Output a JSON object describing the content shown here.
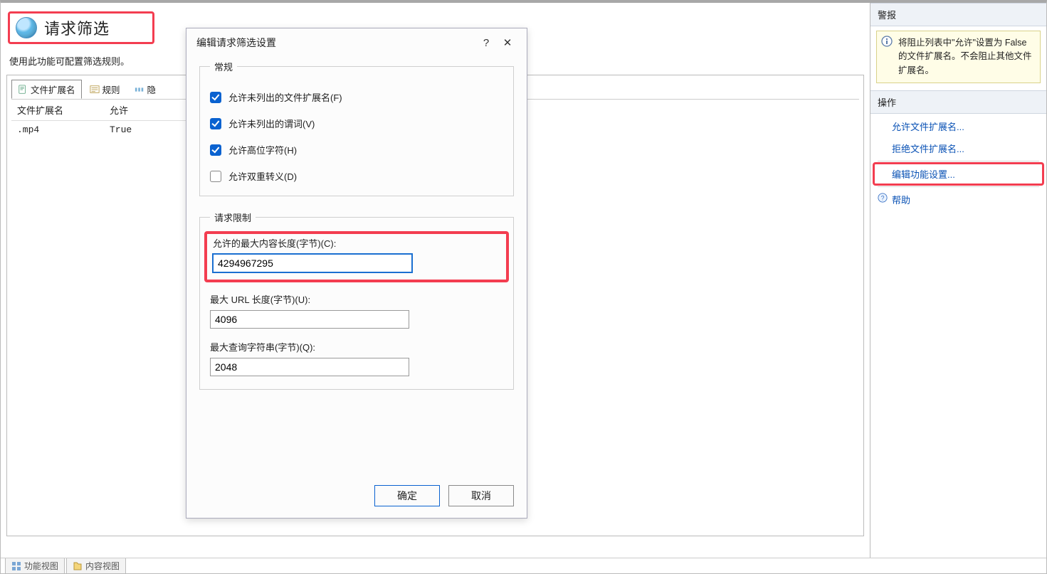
{
  "header": {
    "title": "请求筛选",
    "description": "使用此功能可配置筛选规则。"
  },
  "tabs": {
    "ext": "文件扩展名",
    "rules": "规则",
    "hidden": "隐"
  },
  "table": {
    "col_ext": "文件扩展名",
    "col_allow": "允许",
    "rows": [
      {
        "ext": ".mp4",
        "allow": "True"
      }
    ]
  },
  "dialog": {
    "title": "编辑请求筛选设置",
    "help_symbol": "?",
    "close_symbol": "✕",
    "group_general": "常规",
    "chk_unlisted_ext": "允许未列出的文件扩展名(F)",
    "chk_unlisted_verbs": "允许未列出的谓词(V)",
    "chk_highbit": "允许高位字符(H)",
    "chk_double_escape": "允许双重转义(D)",
    "check_states": {
      "unlisted_ext": true,
      "unlisted_verbs": true,
      "highbit": true,
      "double_escape": false
    },
    "group_limits": "请求限制",
    "lbl_max_content": "允许的最大内容长度(字节)(C):",
    "val_max_content": "4294967295",
    "lbl_max_url": "最大 URL 长度(字节)(U):",
    "val_max_url": "4096",
    "lbl_max_query": "最大查询字符串(字节)(Q):",
    "val_max_query": "2048",
    "btn_ok": "确定",
    "btn_cancel": "取消"
  },
  "right": {
    "alerts_title": "警报",
    "alert_text": "将阻止列表中\"允许\"设置为 False 的文件扩展名。不会阻止其他文件扩展名。",
    "actions_title": "操作",
    "a_allow": "允许文件扩展名...",
    "a_deny": "拒绝文件扩展名...",
    "a_edit": "编辑功能设置...",
    "a_help": "帮助"
  },
  "bottom": {
    "t1": "功能视图",
    "t2": "内容视图"
  }
}
